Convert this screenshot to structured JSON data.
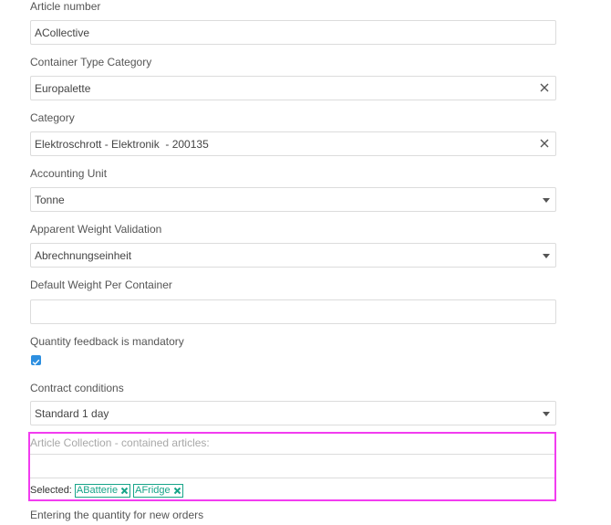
{
  "fields": {
    "article_number": {
      "label": "Article number",
      "value": "ACollective"
    },
    "container_type_category": {
      "label": "Container Type Category",
      "value": "Europalette"
    },
    "category": {
      "label": "Category",
      "value": "Elektroschrott - Elektronik  - 200135"
    },
    "accounting_unit": {
      "label": "Accounting Unit",
      "value": "Tonne"
    },
    "apparent_weight_validation": {
      "label": "Apparent Weight Validation",
      "value": "Abrechnungseinheit"
    },
    "default_weight_per_container": {
      "label": "Default Weight Per Container",
      "value": ""
    },
    "quantity_feedback": {
      "label": "Quantity feedback is mandatory",
      "checked": true
    },
    "contract_conditions": {
      "label": "Contract conditions",
      "value": "Standard 1 day"
    },
    "article_collection": {
      "label": "Article Collection - contained articles:",
      "input_value": "",
      "selected_label": "Selected:",
      "selected": [
        "ABatterie",
        "AFridge"
      ]
    },
    "quantity_entry": {
      "label": "Entering the quantity for new orders"
    }
  },
  "colors": {
    "highlight": "#f23cf0",
    "tag": "#17a589",
    "checkbox": "#2d8fe0"
  },
  "icons": {
    "clear": "close-icon",
    "dropdown": "chevron-down-icon",
    "check": "check-icon",
    "tag_remove": "close-icon"
  }
}
